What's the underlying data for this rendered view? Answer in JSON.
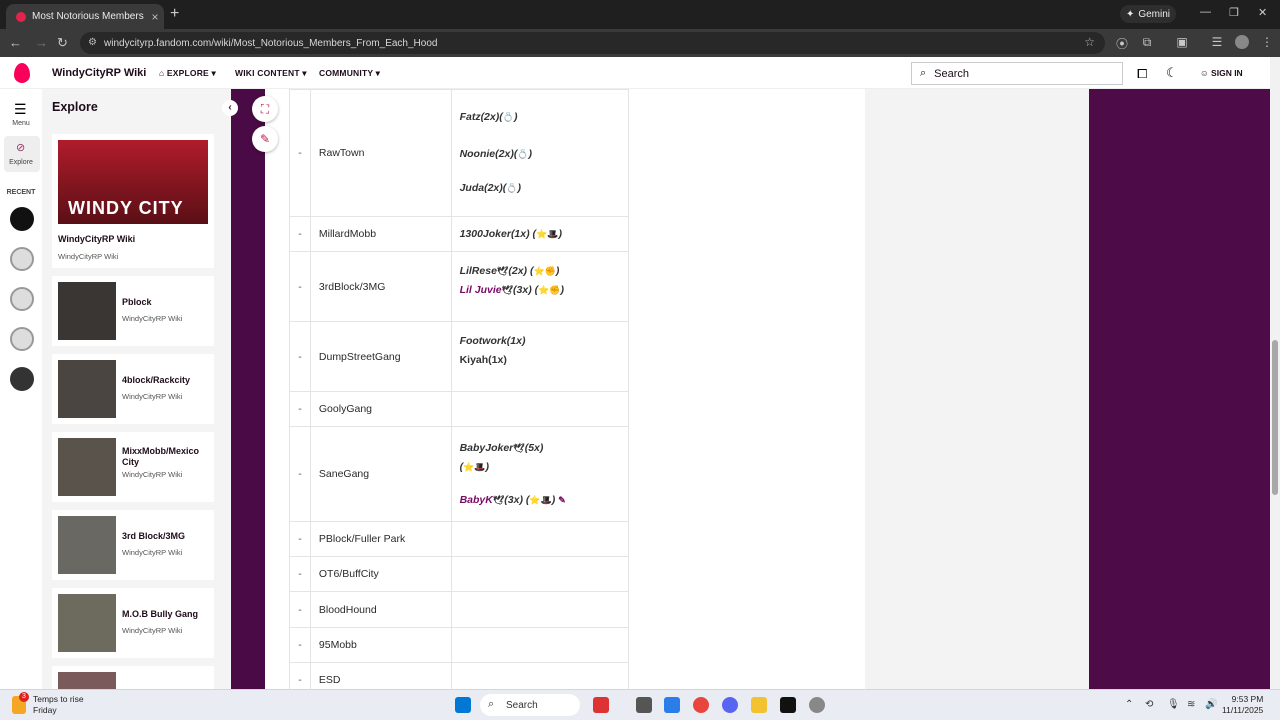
{
  "browser": {
    "tab_title": "Most Notorious Members From",
    "new_tab": "+",
    "tab_close": "×",
    "gemini_label": "Gemini",
    "url": "windycityrp.fandom.com/wiki/Most_Notorious_Members_From_Each_Hood"
  },
  "site": {
    "name": "WindyCityRP Wiki",
    "nav": [
      {
        "label": "EXPLORE"
      },
      {
        "label": "WIKI CONTENT"
      },
      {
        "label": "COMMUNITY"
      }
    ],
    "search_placeholder": "Search",
    "sign_in": "SIGN IN"
  },
  "rail": {
    "menu_label": "Menu",
    "explore_label": "Explore",
    "recent_label": "RECENT"
  },
  "explore_panel": {
    "title": "Explore",
    "featured": {
      "title": "WindyCityRP Wiki",
      "subtitle": "WindyCityRP Wiki",
      "image_text": "WINDY CITY"
    },
    "cards": [
      {
        "title": "Pblock",
        "subtitle": "WindyCityRP Wiki"
      },
      {
        "title": "4block/Rackcity",
        "subtitle": "WindyCityRP Wiki"
      },
      {
        "title": "MixxMobb/Mexico City",
        "subtitle": "WindyCityRP Wiki"
      },
      {
        "title": "3rd Block/3MG",
        "subtitle": "WindyCityRP Wiki"
      },
      {
        "title": "M.O.B Bully Gang",
        "subtitle": "WindyCityRP Wiki"
      }
    ]
  },
  "table": {
    "dash": "-",
    "rows": [
      {
        "hood": "RawTown",
        "members": [
          "Fatz(2x)(",
          "Noonie(2x)(",
          "Juda(2x)("
        ]
      },
      {
        "hood": "MillardMobb",
        "members": [
          "1300Joker(1x) ("
        ]
      },
      {
        "hood": "3rdBlock/3MG",
        "members": [
          "LilRese",
          "(2x) (",
          "Lil Juvie",
          "(3x) ("
        ]
      },
      {
        "hood": "DumpStreetGang",
        "members": [
          "Footwork(1x)",
          "Kiyah(1x)"
        ]
      },
      {
        "hood": "GoolyGang",
        "members": []
      },
      {
        "hood": "SaneGang",
        "members": [
          "BabyJoker",
          "(5x)",
          "(",
          "BabyK",
          "(3x) ("
        ]
      },
      {
        "hood": "PBlock/Fuller Park",
        "members": []
      },
      {
        "hood": "OT6/BuffCity",
        "members": []
      },
      {
        "hood": "BloodHound",
        "members": []
      },
      {
        "hood": "95Mobb",
        "members": []
      },
      {
        "hood": "ESD",
        "members": []
      }
    ],
    "close_paren": ")"
  },
  "taskbar": {
    "weather_line1": "Temps to rise",
    "weather_line2": "Friday",
    "search_label": "Search",
    "time": "9:53 PM",
    "date": "11/11/2025",
    "badge": "3"
  },
  "colors": {
    "brand": "#fa005a",
    "purple_bg": "#4a0a45",
    "link_purple": "#7a0a66"
  }
}
